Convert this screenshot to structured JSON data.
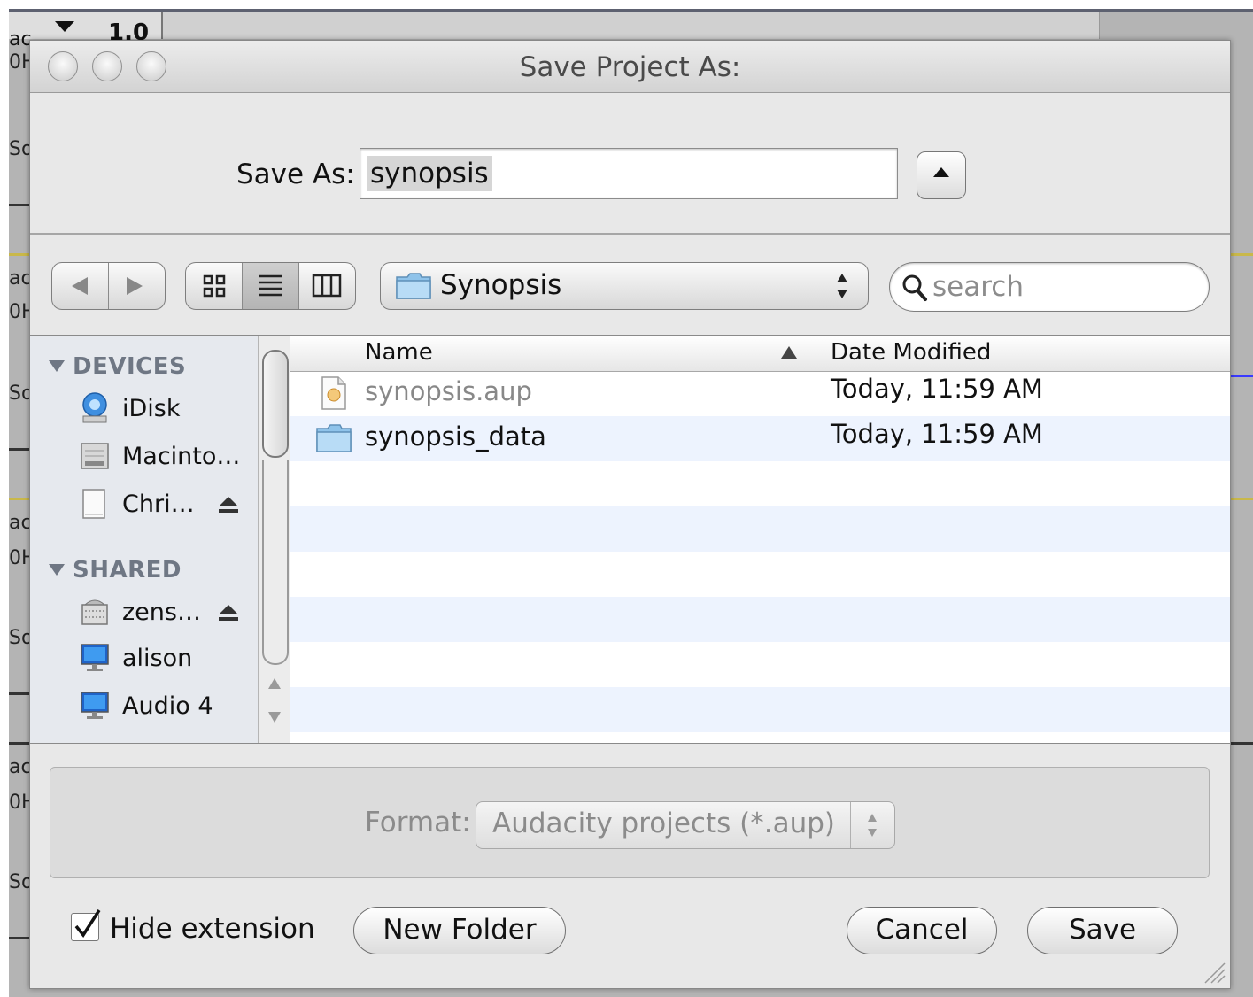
{
  "dialog": {
    "title": "Save Project As:",
    "save_as_label": "Save As:",
    "save_as_value": "synopsis"
  },
  "toolbar": {
    "current_folder": "Synopsis",
    "search_placeholder": "search",
    "view_mode": "list"
  },
  "sidebar": {
    "sections": [
      {
        "heading": "DEVICES",
        "items": [
          {
            "label": "iDisk",
            "icon": "idisk-icon"
          },
          {
            "label": "Macinto…",
            "icon": "hard-drive-icon"
          },
          {
            "label": "Chri…",
            "icon": "disk-icon",
            "ejectable": true
          }
        ]
      },
      {
        "heading": "SHARED",
        "items": [
          {
            "label": "zens…",
            "icon": "server-icon",
            "ejectable": true
          },
          {
            "label": "alison",
            "icon": "computer-icon"
          },
          {
            "label": "Audio 4",
            "icon": "computer-icon"
          }
        ]
      }
    ]
  },
  "file_list": {
    "columns": [
      "Name",
      "Date Modified"
    ],
    "sort_column": "Name",
    "rows": [
      {
        "name": "synopsis.aup",
        "date": "Today, 11:59 AM",
        "kind": "document",
        "enabled": false
      },
      {
        "name": "synopsis_data",
        "date": "Today, 11:59 AM",
        "kind": "folder",
        "enabled": true
      }
    ]
  },
  "format": {
    "label": "Format:",
    "value": "Audacity projects (*.aup)",
    "enabled": false
  },
  "footer": {
    "hide_extension_label": "Hide extension",
    "hide_extension_checked": true,
    "new_folder_label": "New Folder",
    "cancel_label": "Cancel",
    "save_label": "Save"
  },
  "background": {
    "ruler_value": "1.0",
    "track_fragments": [
      "ac",
      "0H",
      "So",
      "ac",
      "0H",
      "So",
      "ac",
      "0H",
      "So",
      "ac",
      "0H",
      "So"
    ]
  }
}
